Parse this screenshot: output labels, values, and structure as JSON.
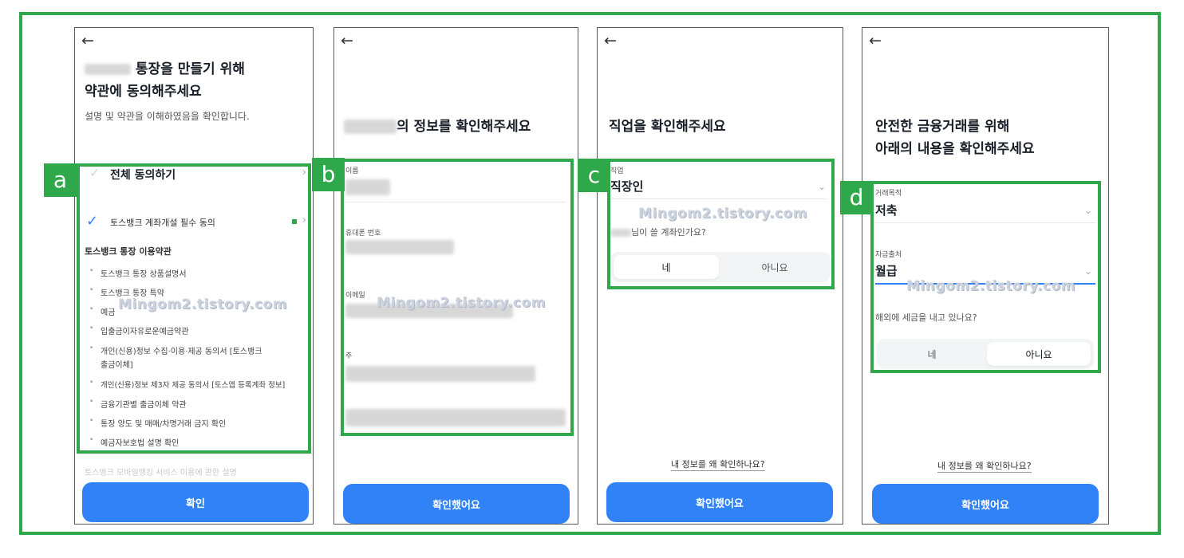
{
  "colors": {
    "accent": "#2ea84a",
    "primary": "#3182f6"
  },
  "watermark": "Mingom2.tistory.com",
  "labels": {
    "a": "a",
    "b": "b",
    "c": "c",
    "d": "d"
  },
  "screen_a": {
    "back_icon": "←",
    "title_line1": "통장을 만들기 위해",
    "title_line2": "약관에 동의해주세요",
    "subtitle": "설명 및 약관을 이해하였음을 확인합니다.",
    "agree_all": "전체 동의하기",
    "required": "토스뱅크 계좌개설 필수 동의",
    "section": "토스뱅크 통장 이용약관",
    "items": [
      "토스뱅크 통장 상품설명서",
      "토스뱅크 통장 특약",
      "예금",
      "입출금이자유로운예금약관",
      "개인(신용)정보 수집·이용·제공 동의서 [토스뱅크",
      "출금이체]",
      "개인(신용)정보 제3자 제공 동의서 [토스앱 등록계좌 정보]",
      "금융기관별 출금이체 약관",
      "통장 양도 및 매매/차명거래 금지 확인",
      "예금자보호법 설명 확인"
    ],
    "footer_text": "토스뱅크 모바일뱅킹 서비스 이용에 관한 설명",
    "button": "확인"
  },
  "screen_b": {
    "back_icon": "←",
    "title": "의 정보를 확인해주세요",
    "name_label": "이름",
    "phone_label": "휴대폰 번호",
    "email_label": "이메일",
    "address_label": "주",
    "button": "확인했어요"
  },
  "screen_c": {
    "back_icon": "←",
    "title": "직업을 확인해주세요",
    "job_label": "직업",
    "job_value": "직장인",
    "question": "님이 쓸 계좌인가요?",
    "yes": "네",
    "no": "아니요",
    "why_link": "내 정보를 왜 확인하나요?",
    "button": "확인했어요"
  },
  "screen_d": {
    "back_icon": "←",
    "title_line1": "안전한 금융거래를 위해",
    "title_line2": "아래의 내용을 확인해주세요",
    "purpose_label": "거래목적",
    "purpose_value": "저축",
    "source_label": "자금출처",
    "source_value": "월급",
    "tax_question": "해외에 세금을 내고 있나요?",
    "yes": "네",
    "no": "아니요",
    "why_link": "내 정보를 왜 확인하나요?",
    "button": "확인했어요"
  }
}
